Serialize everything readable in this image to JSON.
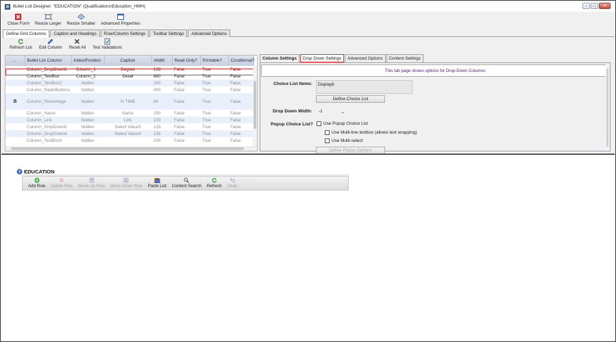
{
  "window": {
    "title": "Bullet List Designer: \"EDUCATION\" (Qualifications\\Education_HMH)",
    "controls": [
      "minimize",
      "maximize",
      "close"
    ]
  },
  "toolbar": {
    "buttons": [
      {
        "label": "Close Form",
        "icon": "close-form-icon"
      },
      {
        "label": "Resize Larger",
        "icon": "resize-larger-icon"
      },
      {
        "label": "Resize Smaller",
        "icon": "resize-smaller-icon"
      },
      {
        "label": "Advanced Properties",
        "icon": "advanced-properties-icon"
      }
    ]
  },
  "main_tabs": [
    {
      "label": "Define Grid Columns",
      "active": true
    },
    {
      "label": "Caption and Headings"
    },
    {
      "label": "Row/Column Settings"
    },
    {
      "label": "Toolbar Settings"
    },
    {
      "label": "Advanced Options"
    }
  ],
  "grid_toolbar": {
    "buttons": [
      {
        "label": "Refresh List",
        "icon": "refresh-icon"
      },
      {
        "label": "Edit Column",
        "icon": "pencil-icon"
      },
      {
        "label": "Reset All",
        "icon": "reset-x-icon"
      },
      {
        "label": "Test Validations",
        "icon": "test-validations-icon"
      }
    ]
  },
  "grid": {
    "headers": [
      "...",
      "Bullet List Column",
      "Index/Position",
      "Caption",
      "Width",
      "Read Only?",
      "Printable?",
      "Conditional?"
    ],
    "rows": [
      {
        "marker": "",
        "column": "Column_DropDown6",
        "index": "Column_1",
        "caption": "Degree",
        "width": "133",
        "read_only": "False",
        "printable": "True",
        "conditional": "False",
        "state": "selected"
      },
      {
        "marker": "",
        "column": "Column_TextBox",
        "index": "Column_2",
        "caption": "Detail",
        "width": "880",
        "read_only": "False",
        "printable": "True",
        "conditional": "False",
        "state": "normal"
      },
      {
        "marker": "",
        "column": "Column_TextBox2",
        "index": "hidden",
        "caption": "",
        "width": "200",
        "read_only": "False",
        "printable": "True",
        "conditional": "False",
        "state": "hidden"
      },
      {
        "marker": "",
        "column": "Column_RadioButtons",
        "index": "hidden",
        "caption": "",
        "width": "400",
        "read_only": "False",
        "printable": "True",
        "conditional": "False",
        "state": "hidden"
      },
      {
        "marker": "B",
        "column": "Column_Percentage",
        "index": "hidden",
        "caption": "% TIME",
        "width": "80",
        "read_only": "False",
        "printable": "True",
        "conditional": "False",
        "state": "hidden-tall"
      },
      {
        "marker": "",
        "column": "Column_Name",
        "index": "hidden",
        "caption": "Name",
        "width": "250",
        "read_only": "False",
        "printable": "True",
        "conditional": "False",
        "state": "hidden"
      },
      {
        "marker": "",
        "column": "Column_Link",
        "index": "hidden",
        "caption": "Link",
        "width": "133",
        "read_only": "False",
        "printable": "True",
        "conditional": "False",
        "state": "hidden"
      },
      {
        "marker": "",
        "column": "Column_DropDown5",
        "index": "hidden",
        "caption": "Select Value5",
        "width": "133",
        "read_only": "False",
        "printable": "True",
        "conditional": "False",
        "state": "hidden"
      },
      {
        "marker": "",
        "column": "Column_DropDown4",
        "index": "hidden",
        "caption": "Select Value4",
        "width": "133",
        "read_only": "False",
        "printable": "True",
        "conditional": "False",
        "state": "hidden"
      },
      {
        "marker": "",
        "column": "Column_TextBox4",
        "index": "hidden",
        "caption": "",
        "width": "200",
        "read_only": "False",
        "printable": "True",
        "conditional": "False",
        "state": "hidden"
      }
    ]
  },
  "detail_tabs": [
    {
      "label": "Column Settings"
    },
    {
      "label": "Drop Down Settings",
      "active": true
    },
    {
      "label": "Advanced Options"
    },
    {
      "label": "Content Settings"
    }
  ],
  "dropdown_settings": {
    "info": "This tab page shows options for Drop-Down Columns",
    "choice_list_label": "Choice List Items:",
    "choice_list_value": "Display6",
    "define_choice_button": "Define Choice List",
    "drop_down_width_label": "Drop Down Width:",
    "drop_down_width_value": "-1",
    "popup_label": "Popup  Choice List?",
    "use_popup": "Use Popup Choice List",
    "use_multiline": "Use Multi-line textbox (allows text wrapping)",
    "use_multiselect": "Use Multi-select",
    "define_popup_button": "Define Popup Options"
  },
  "preview": {
    "title": "EDUCATION",
    "buttons": [
      {
        "label": "Add Row",
        "icon": "add-icon",
        "enabled": true
      },
      {
        "label": "Delete Row",
        "icon": "delete-icon",
        "enabled": false
      },
      {
        "label": "Move Up Row",
        "icon": "move-up-icon",
        "enabled": false
      },
      {
        "label": "Move Down Row",
        "icon": "move-down-icon",
        "enabled": false
      },
      {
        "label": "Paste List",
        "icon": "paste-icon",
        "enabled": true
      },
      {
        "label": "Content Search",
        "icon": "search-icon",
        "enabled": true
      },
      {
        "label": "Refresh",
        "icon": "refresh-icon",
        "enabled": true
      },
      {
        "label": "Undo",
        "icon": "undo-icon",
        "enabled": false
      }
    ]
  },
  "colors": {
    "selection_outline": "#dd3333",
    "header_bg": "#c7d0e0",
    "alt_row_bg": "#e9f0fb",
    "info_text": "#4a1a7a"
  }
}
